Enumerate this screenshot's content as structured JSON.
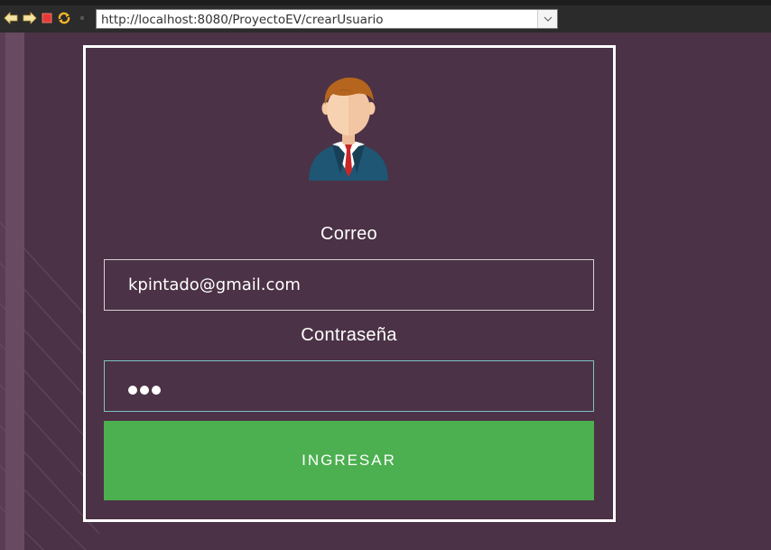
{
  "browser": {
    "url": "http://localhost:8080/ProyectoEV/crearUsuario",
    "icons": [
      "back-arrow-icon",
      "forward-arrow-icon",
      "stop-icon",
      "refresh-icon",
      "chevron-down-icon"
    ]
  },
  "login": {
    "avatar_icon": "user-avatar-icon",
    "email_label": "Correo",
    "email_value": "kpintado@gmail.com",
    "password_label": "Contraseña",
    "password_length": 3,
    "submit_label": "INGRESAR"
  },
  "colors": {
    "background": "#4b3246",
    "button": "#4caf50",
    "focus_border": "#7fc3c2",
    "toolbar": "#2b2b2b"
  }
}
